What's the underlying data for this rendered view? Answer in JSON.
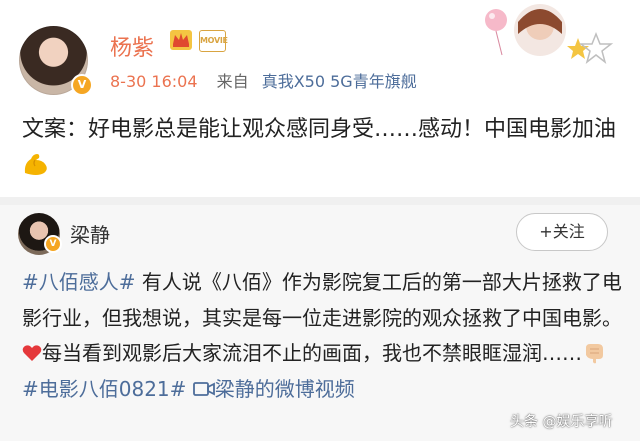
{
  "post": {
    "username": "杨紫",
    "movie_badge": "MOVIE",
    "time": "8-30 16:04",
    "from_label": "来自",
    "device": "真我X50 5G青年旗舰",
    "text": "文案：好电影总是能让观众感同身受……感动！中国电影加油",
    "emoji": "flexed-biceps-icon"
  },
  "repost": {
    "username": "梁静",
    "follow_label": "+关注",
    "hashtag1": "#八佰感人#",
    "text_part1": " 有人说《八佰》作为影院复工后的第一部大片拯救了电影行业，但我想说，其实是每一位走进影院的观众拯救了中国电影。",
    "text_part2": "每当看到观影后大家流泪不止的画面，我也不禁眼眶湿润……",
    "hashtag2": "#电影八佰0821#",
    "video_link": "梁静的微博视频"
  },
  "watermark": "头条 @娱乐享听",
  "colors": {
    "accent_name": "#eb7350",
    "link": "#4d6d9a",
    "badge": "#f5a623"
  }
}
